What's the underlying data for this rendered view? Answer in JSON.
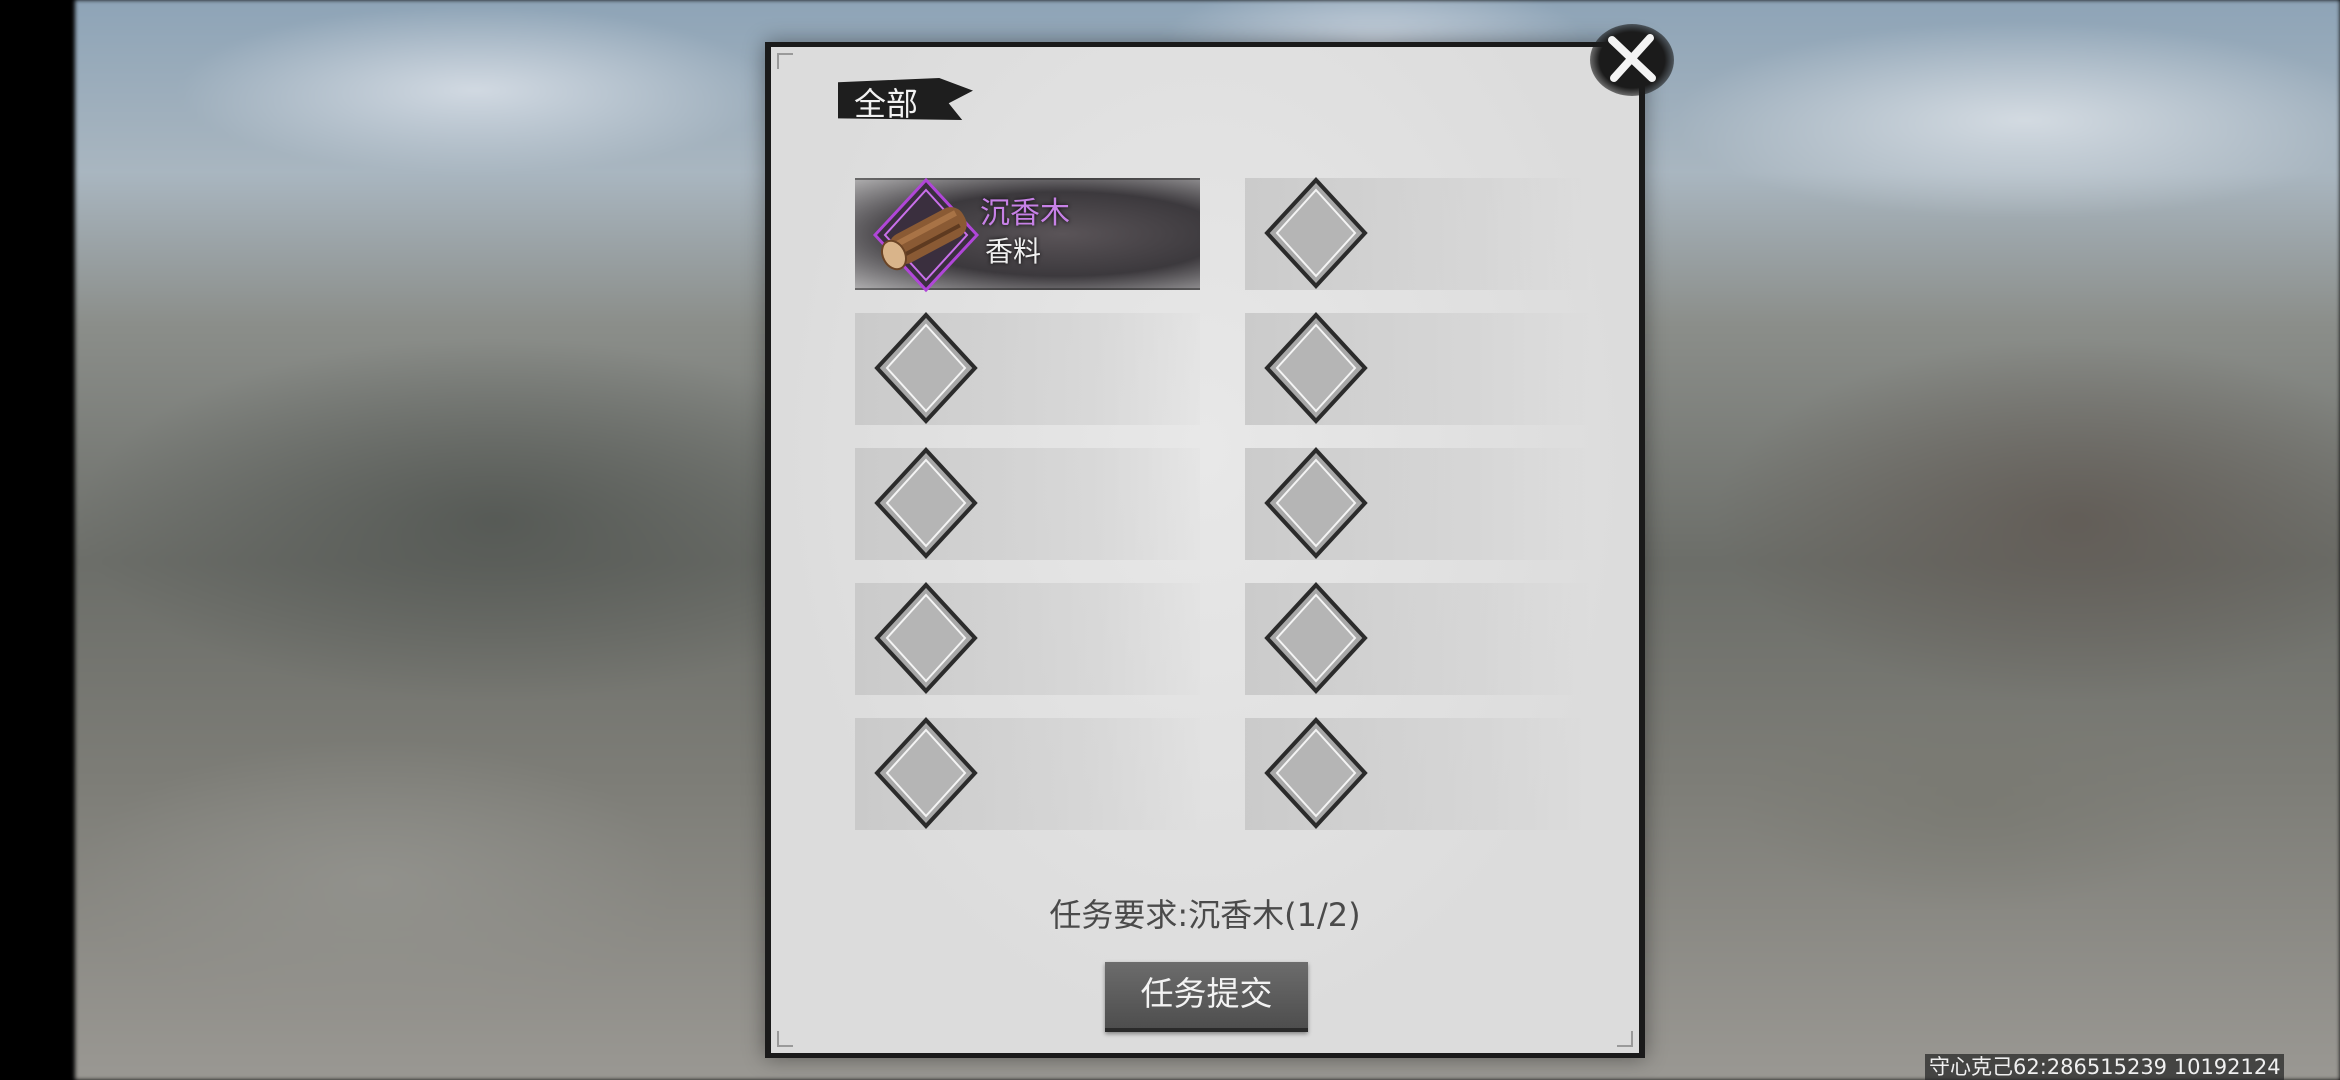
{
  "panel": {
    "tab_label": "全部",
    "close_icon": "close-icon"
  },
  "inventory": {
    "slots": [
      {
        "filled": true,
        "name": "沉香木",
        "type": "香料",
        "icon": "agarwood-log-icon",
        "rarity_color": "#b046d8"
      },
      {
        "filled": false
      },
      {
        "filled": false
      },
      {
        "filled": false
      },
      {
        "filled": false
      },
      {
        "filled": false
      },
      {
        "filled": false
      },
      {
        "filled": false
      },
      {
        "filled": false
      },
      {
        "filled": false
      }
    ]
  },
  "task": {
    "requirement": "任务要求:沉香木(1/2)",
    "submit_label": "任务提交"
  },
  "overlay": {
    "watermark": "守心克己62:286515239 10192124"
  },
  "colors": {
    "item_name": "#c781e6",
    "panel_bg": "#dcdcdc",
    "button_bg": "#5c5c5c"
  }
}
